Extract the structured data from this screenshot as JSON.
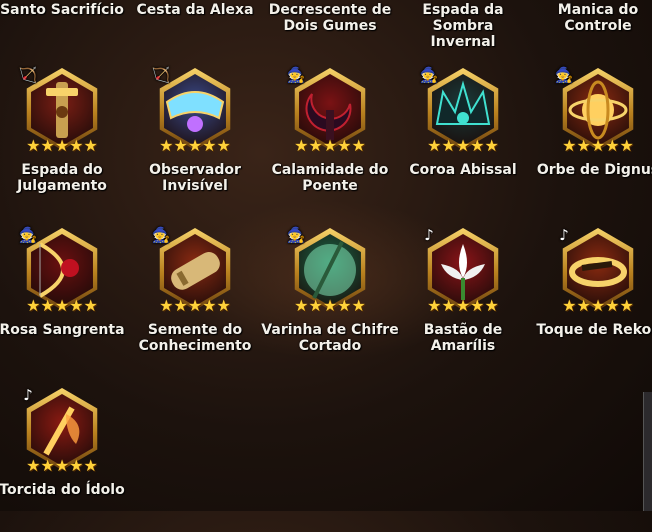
{
  "top_row": [
    "Santo Sacrifício",
    "Cesta da Alexa",
    "Decrescente de Dois Gumes",
    "Espada da Sombra Invernal",
    "Manica do Controle"
  ],
  "star_glyph": "★",
  "colors": {
    "gold": "#f7d36a",
    "star": "#ffd23a",
    "text": "#f4f1ea"
  },
  "items": [
    {
      "name": "Espada do Julgamento",
      "class_icon": "bow-icon",
      "stars": 5,
      "art": "sword-hilt-icon",
      "bg": "#7a1e14"
    },
    {
      "name": "Observador Invisível",
      "class_icon": "bow-icon",
      "stars": 5,
      "art": "visor-icon",
      "bg": "#3a4a8a"
    },
    {
      "name": "Calamidade do Poente",
      "class_icon": "mage-hat-icon",
      "stars": 5,
      "art": "crescent-blade-icon",
      "bg": "#7a1214"
    },
    {
      "name": "Coroa Abissal",
      "class_icon": "mage-hat-icon",
      "stars": 5,
      "art": "crown-icon",
      "bg": "#1a3a3a"
    },
    {
      "name": "Orbe de Dignus",
      "class_icon": "mage-hat-icon",
      "stars": 5,
      "art": "orb-icon",
      "bg": "#8a2a10"
    },
    {
      "name": "Rosa Sangrenta",
      "class_icon": "mage-hat-icon",
      "stars": 5,
      "art": "rose-bow-icon",
      "bg": "#6a1010"
    },
    {
      "name": "Semente do Conhecimento",
      "class_icon": "mage-hat-icon",
      "stars": 5,
      "art": "scroll-icon",
      "bg": "#8a2a12"
    },
    {
      "name": "Varinha de Chifre Cortado",
      "class_icon": "mage-hat-icon",
      "stars": 5,
      "art": "wand-icon",
      "bg": "#1a6a4a"
    },
    {
      "name": "Bastão de Amarílis",
      "class_icon": "music-note-icon",
      "stars": 5,
      "art": "flower-icon",
      "bg": "#8a1418"
    },
    {
      "name": "Toque de Rekos",
      "class_icon": "music-note-icon",
      "stars": 5,
      "art": "ring-icon",
      "bg": "#8a2a10"
    },
    {
      "name": "Torcida do Ídolo",
      "class_icon": "music-note-icon",
      "stars": 5,
      "art": "lightstick-icon",
      "bg": "#8a1a12"
    }
  ]
}
